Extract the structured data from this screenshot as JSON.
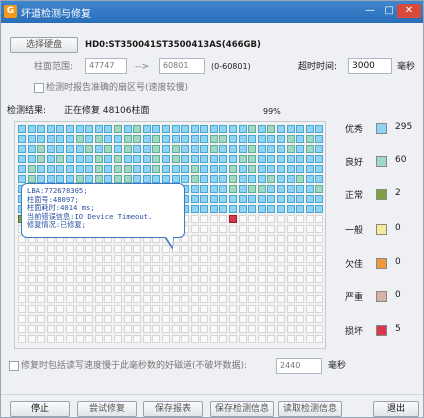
{
  "window": {
    "title": "坏道检测与修复"
  },
  "disk": {
    "select_button": "选择硬盘",
    "info": "HD0:ST350041ST3500413AS(466GB)"
  },
  "range": {
    "label": "柱面范围:",
    "start": "47747",
    "arrow": "-->",
    "end": "60801",
    "hint": "(0-60801)"
  },
  "timeout": {
    "label": "超时时间:",
    "value": "3000",
    "unit": "毫秒"
  },
  "accurate_sector": {
    "checked": false,
    "label": "检测时报告准确的扇区号(速度较慢)"
  },
  "status": {
    "result_label": "检测结果:",
    "progress_text": "正在修复 48106柱面",
    "percent": "99%"
  },
  "tooltip": {
    "lines": [
      "LBA:772678305;",
      "柱面号:48097;",
      "柱面耗时:4014 ms;",
      "当前错误信息:IO Device Timeout.",
      "修复情况:已修复;"
    ]
  },
  "grid": {
    "columns": 32,
    "rows": 22,
    "sequence": "EEEEEEEEEEEEEEEEEEEEEEEEEEEEEEEEEEEEEEEEEEEEEEEEEEEEGEEEEEEEEEEEEEEEEEEGEEEEEEEEEEEEEEEEEEEEGEGEEEEEEEEEEEEEEEEEEEEEEEEEEEEEEEEGEEEEEEEEEGEEEEEEEEEEEEEEEEEEGEEEEEEEEEEEEEEGEEEEEEEEEEEEEEEEEEGEEEEEEEEEEEGEEEEEEEEEEEEEGEEEEEEEEEEEEEEEEEEEEEGEEEEEEEEEEEGEEEEEEEEEEEEEEEEEEEEEEEEEEEEEEEEEEEEEEEEEEGEEEEEEEEEEEEEEEEEEEEEEEEEEEEEEEEEEEEEEEEEEEEEEEEEEEEEEEEEEEEEEEEEEEEEEEEEEEEEEEEEEEEEEEEEEEEEEEEEEEEEEEEEEEEEEEEEEEEEEEEEEEEEEEEEEEEEEEEEEEEEEEEEEEEEEEEEEEEEEEEEEEEEEEEEEEEEEEEEEEEEEEEEEEEEEEEEEEEEEEEEEEEEEEEEEEEEEEEEEEEEEEEEEEEEEEEEEEEEEEEEEEEEEEEEEEEEEEEEEEEEEEEEEEEEEEEEEEEEEEEEEEEEEEEEEEEEEEEEEEEEEEEEEEEEEEEEEEEEEEEEEEEEEEEEEEEEEEEEEEEEEEEEEEEEEEEEEEEEEEEEEEEEEEEEEEEEEEEEEEEEEEEEEEEEEEEEEEEEEEEEEEEEEEEEEEEEEEEEEEEEEEEEEEEEEEEEEEEEEEEEEEEEEEEEEEEEEEEEEEEEEEEEEEEEEEEEEEEEEEEEEEEEEEEEEEEEEEEEEEEEEEEEEEEEEEEEEEEEEEEEEEEEEEEEEEEEEEEEEEEEEEEEEEEEEEEEEEEEEEEEEEEEEEEEEEEEEEEEEEEEEEEEEEEEEEEEEEEEEEEEEEEEEEEEEEEEEEEEEEEEEEEEEEEEEEEEEEEEEEEEEEEEEEEEEEEEEEEEEEEEEEEEEEEEEEEEEEEEEEEEEEEEEEEEEEEEEEEEEEEEEEEEEEEEEEEEEEEEEEEEEEEEEEEEEEEEEEEEEEEEEEEEEEEEEEEEEEEEEEEEEEEEEEEEEEEEEEEEEEEEEEEEEEEEEEEEEEEEEEEEEEEEEEEEEEE",
    "counts": [
      295,
      60,
      2,
      0,
      0,
      0,
      5
    ]
  },
  "legend": [
    {
      "key": "excellent",
      "label": "优秀",
      "count": "295",
      "color": "#8fd4f5"
    },
    {
      "key": "good",
      "label": "良好",
      "count": "60",
      "color": "#9fd8c4"
    },
    {
      "key": "normal",
      "label": "正常",
      "count": "2",
      "color": "#7ea240"
    },
    {
      "key": "fair",
      "label": "一般",
      "count": "0",
      "color": "#f4ec9c"
    },
    {
      "key": "slow",
      "label": "欠佳",
      "count": "0",
      "color": "#f09a3c"
    },
    {
      "key": "severe",
      "label": "严重",
      "count": "0",
      "color": "#d6b3a4"
    },
    {
      "key": "bad",
      "label": "损坏",
      "count": "5",
      "color": "#d8374a"
    }
  ],
  "repair_option": {
    "checked": false,
    "label": "修复时包括读写速度慢于此毫秒数的好磁道(不破坏数据):",
    "value": "2440",
    "unit": "毫秒"
  },
  "buttons": {
    "stop": "停止",
    "try_repair": "尝试修复",
    "save_report": "保存报表",
    "save_info": "保存检测信息",
    "read_info": "读取检测信息",
    "exit": "退出"
  }
}
